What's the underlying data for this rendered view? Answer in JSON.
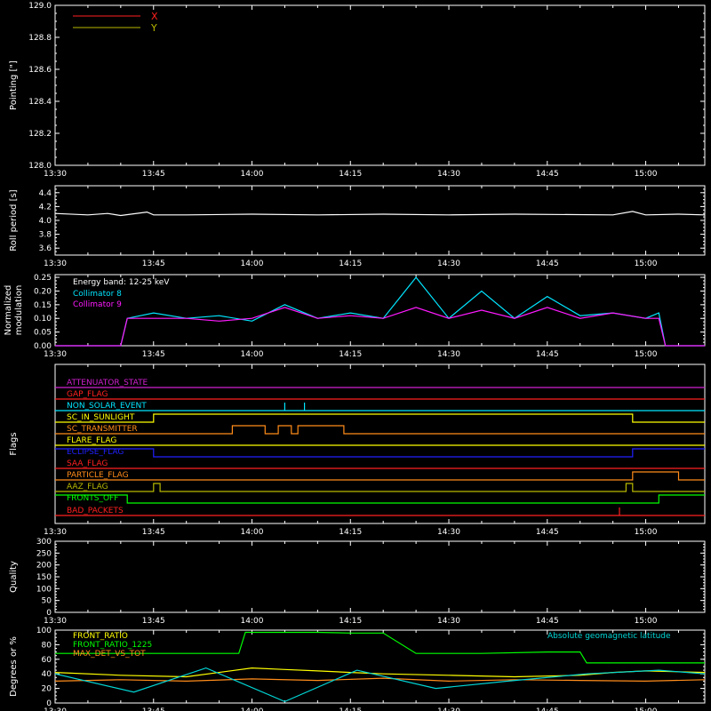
{
  "time_ticks": [
    "13:30",
    "13:45",
    "14:00",
    "14:15",
    "14:30",
    "14:45",
    "15:00"
  ],
  "chart_data": [
    {
      "type": "line",
      "id": "pointing",
      "ylabel": "Pointing [\"]",
      "ylim": [
        128.0,
        129.0
      ],
      "yticks": [
        "128.0",
        "128.2",
        "128.4",
        "128.6",
        "128.8",
        "129.0"
      ],
      "legend": "top-left",
      "series": [
        {
          "name": "X",
          "color": "#ff2020",
          "x": [],
          "y": []
        },
        {
          "name": "Y",
          "color": "#b8b800",
          "x": [],
          "y": []
        }
      ]
    },
    {
      "type": "line",
      "id": "roll",
      "ylabel": "Roll period [s]",
      "ylim": [
        3.5,
        4.5
      ],
      "yticks": [
        "3.6",
        "3.8",
        "4.0",
        "4.2",
        "4.4"
      ],
      "series": [
        {
          "name": "",
          "color": "#ffffff",
          "x": [
            "13:30",
            "13:35",
            "13:38",
            "13:40",
            "13:44",
            "13:45",
            "13:50",
            "14:00",
            "14:10",
            "14:20",
            "14:30",
            "14:40",
            "14:55",
            "14:58",
            "15:00",
            "15:05",
            "15:09"
          ],
          "y": [
            4.1,
            4.08,
            4.1,
            4.07,
            4.12,
            4.08,
            4.08,
            4.09,
            4.08,
            4.09,
            4.08,
            4.09,
            4.08,
            4.13,
            4.08,
            4.09,
            4.08
          ]
        }
      ]
    },
    {
      "type": "line",
      "id": "modulation",
      "ylabel": "Normalized modulation",
      "ylim": [
        0.0,
        0.26
      ],
      "yticks": [
        "0.00",
        "0.05",
        "0.10",
        "0.15",
        "0.20",
        "0.25"
      ],
      "annotation": "Energy band: 12-25 keV",
      "legend": "top-left",
      "series": [
        {
          "name": "Collimator 8",
          "color": "#00e5ff",
          "x": [
            "13:30",
            "13:40",
            "13:41",
            "13:45",
            "13:50",
            "13:55",
            "14:00",
            "14:05",
            "14:10",
            "14:15",
            "14:20",
            "14:25",
            "14:30",
            "14:35",
            "14:40",
            "14:45",
            "14:50",
            "14:55",
            "15:00",
            "15:02",
            "15:03",
            "15:09"
          ],
          "y": [
            0.0,
            0.0,
            0.1,
            0.12,
            0.1,
            0.11,
            0.09,
            0.15,
            0.1,
            0.12,
            0.1,
            0.25,
            0.1,
            0.2,
            0.1,
            0.18,
            0.11,
            0.12,
            0.1,
            0.12,
            0.0,
            0.0
          ]
        },
        {
          "name": "Collimator 9",
          "color": "#ff1aff",
          "x": [
            "13:30",
            "13:40",
            "13:41",
            "13:45",
            "13:50",
            "13:55",
            "14:00",
            "14:05",
            "14:10",
            "14:15",
            "14:20",
            "14:25",
            "14:30",
            "14:35",
            "14:40",
            "14:45",
            "14:50",
            "14:55",
            "15:00",
            "15:02",
            "15:03",
            "15:09"
          ],
          "y": [
            0.0,
            0.0,
            0.1,
            0.1,
            0.1,
            0.09,
            0.1,
            0.14,
            0.1,
            0.11,
            0.1,
            0.14,
            0.1,
            0.13,
            0.1,
            0.14,
            0.1,
            0.12,
            0.1,
            0.1,
            0.0,
            0.0
          ]
        }
      ]
    },
    {
      "type": "line",
      "id": "flags",
      "ylabel": "Flags",
      "series": [
        {
          "name": "ATTENUATOR_STATE",
          "color": "#d020d0",
          "x": [
            "13:30",
            "15:09"
          ],
          "y": [
            0,
            0
          ]
        },
        {
          "name": "GAP_FLAG",
          "color": "#ff2020",
          "x": [
            "13:30",
            "15:09"
          ],
          "y": [
            0,
            0
          ]
        },
        {
          "name": "NON_SOLAR_EVENT",
          "color": "#00e5ff",
          "x": [
            "13:30",
            "14:05",
            "14:05",
            "14:05",
            "14:08",
            "14:08",
            "14:08",
            "15:09"
          ],
          "y": [
            0,
            0,
            1,
            0,
            0,
            1,
            0,
            0
          ]
        },
        {
          "name": "SC_IN_SUNLIGHT",
          "color": "#ffff00",
          "x": [
            "13:30",
            "13:45",
            "13:45",
            "14:58",
            "14:58",
            "15:09"
          ],
          "y": [
            0,
            0,
            1,
            1,
            0,
            0
          ]
        },
        {
          "name": "SC_TRANSMITTER",
          "color": "#ff8c1a",
          "x": [
            "13:30",
            "13:57",
            "13:57",
            "14:02",
            "14:02",
            "14:04",
            "14:04",
            "14:06",
            "14:06",
            "14:07",
            "14:07",
            "14:14",
            "14:14",
            "15:09"
          ],
          "y": [
            0,
            0,
            1,
            1,
            0,
            0,
            1,
            1,
            0,
            0,
            1,
            1,
            0,
            0
          ]
        },
        {
          "name": "FLARE_FLAG",
          "color": "#ffff00",
          "x": [
            "13:30",
            "15:09"
          ],
          "y": [
            0,
            0
          ]
        },
        {
          "name": "ECLIPSE_FLAG",
          "color": "#2020ff",
          "x": [
            "13:30",
            "13:45",
            "13:45",
            "14:58",
            "14:58",
            "15:09"
          ],
          "y": [
            1,
            1,
            0,
            0,
            1,
            1
          ]
        },
        {
          "name": "SAA_FLAG",
          "color": "#ff2020",
          "x": [
            "13:30",
            "15:09"
          ],
          "y": [
            0,
            0
          ]
        },
        {
          "name": "PARTICLE_FLAG",
          "color": "#ff8c1a",
          "x": [
            "13:30",
            "14:58",
            "14:58",
            "15:05",
            "15:05",
            "15:09"
          ],
          "y": [
            0,
            0,
            1,
            1,
            0,
            0
          ]
        },
        {
          "name": "AAZ_FLAG",
          "color": "#b8b800",
          "x": [
            "13:30",
            "13:45",
            "13:45",
            "13:46",
            "13:46",
            "14:57",
            "14:57",
            "14:58",
            "14:58",
            "15:09"
          ],
          "y": [
            0,
            0,
            1,
            1,
            0,
            0,
            1,
            1,
            0,
            0
          ]
        },
        {
          "name": "FRONTS_OFF",
          "color": "#00ff00",
          "x": [
            "13:30",
            "13:41",
            "13:41",
            "15:02",
            "15:02",
            "15:09"
          ],
          "y": [
            1,
            1,
            0,
            0,
            1,
            1
          ]
        },
        {
          "name": "BAD_PACKETS",
          "color": "#ff2020",
          "x": [
            "13:30",
            "14:56",
            "14:56",
            "14:56",
            "15:09"
          ],
          "y": [
            0,
            0,
            1,
            0,
            0
          ]
        }
      ]
    },
    {
      "type": "line",
      "id": "quality",
      "ylabel": "Quality",
      "ylim": [
        0,
        300
      ],
      "yticks": [
        "0",
        "50",
        "100",
        "150",
        "200",
        "250",
        "300"
      ],
      "series": []
    },
    {
      "type": "line",
      "id": "ratios",
      "ylabel": "Degrees or %",
      "ylim": [
        0,
        100
      ],
      "yticks": [
        "0",
        "20",
        "40",
        "60",
        "80",
        "100"
      ],
      "legend": "top-left",
      "series": [
        {
          "name": "FRONT_RATIO",
          "color": "#ffff00",
          "x": [
            "13:30",
            "13:40",
            "13:50",
            "14:00",
            "14:05",
            "14:10",
            "14:15",
            "14:20",
            "14:30",
            "14:40",
            "14:50",
            "14:55",
            "15:00",
            "15:09"
          ],
          "y": [
            42,
            38,
            36,
            48,
            46,
            44,
            42,
            40,
            38,
            36,
            38,
            42,
            44,
            42
          ]
        },
        {
          "name": "FRONT_RATIO_1225",
          "color": "#00ff00",
          "x": [
            "13:30",
            "13:58",
            "13:59",
            "14:10",
            "14:15",
            "14:20",
            "14:25",
            "14:35",
            "14:45",
            "14:50",
            "14:51",
            "15:09"
          ],
          "y": [
            68,
            68,
            97,
            97,
            96,
            96,
            68,
            68,
            70,
            70,
            55,
            55
          ]
        },
        {
          "name": "MAX_DET_VS_TOT",
          "color": "#ff8c1a",
          "x": [
            "13:30",
            "13:40",
            "13:50",
            "14:00",
            "14:10",
            "14:20",
            "14:30",
            "14:40",
            "14:50",
            "15:00",
            "15:09"
          ],
          "y": [
            30,
            32,
            30,
            33,
            31,
            34,
            30,
            32,
            31,
            30,
            32
          ]
        },
        {
          "name": "Absolute geomagnetic latitude",
          "color": "#00d5d5",
          "x": [
            "13:30",
            "13:42",
            "13:53",
            "14:05",
            "14:16",
            "14:28",
            "14:39",
            "14:51",
            "15:02",
            "15:09"
          ],
          "y": [
            40,
            15,
            48,
            2,
            45,
            20,
            30,
            40,
            45,
            40
          ]
        }
      ]
    }
  ]
}
